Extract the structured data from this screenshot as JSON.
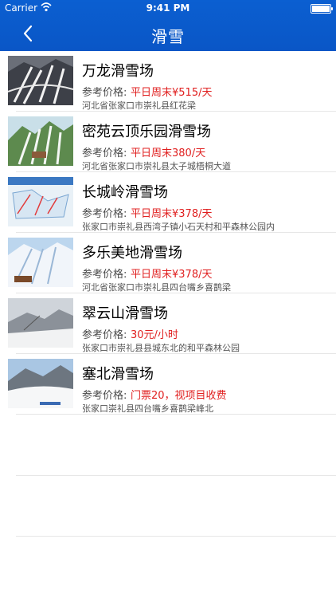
{
  "status": {
    "carrier": "Carrier",
    "time": "9:41 PM"
  },
  "nav": {
    "title": "滑雪"
  },
  "price_label": "参考价格:",
  "resorts": [
    {
      "name": "万龙滑雪场",
      "price": "平日周末¥515/天",
      "address": "河北省张家口市崇礼县红花梁"
    },
    {
      "name": "密苑云顶乐园滑雪场",
      "price": "平日周末380/天",
      "address": "河北省张家口市崇礼县太子城梧桐大道"
    },
    {
      "name": "长城岭滑雪场",
      "price": "平日周末¥378/天",
      "address": "张家口市崇礼县西湾子镇小石天村和平森林公园内"
    },
    {
      "name": "多乐美地滑雪场",
      "price": "平日周末¥378/天",
      "address": "河北省张家口市崇礼县四台嘴乡喜鹊梁"
    },
    {
      "name": "翠云山滑雪场",
      "price": "30元/小时",
      "address": "张家口市崇礼县县城东北的和平森林公园"
    },
    {
      "name": "塞北滑雪场",
      "price": "门票20，视项目收费",
      "address": "张家口崇礼县四台嘴乡喜鹊梁峰北"
    }
  ],
  "colors": {
    "nav_bg": "#0b5fd1",
    "price": "#e02020"
  }
}
